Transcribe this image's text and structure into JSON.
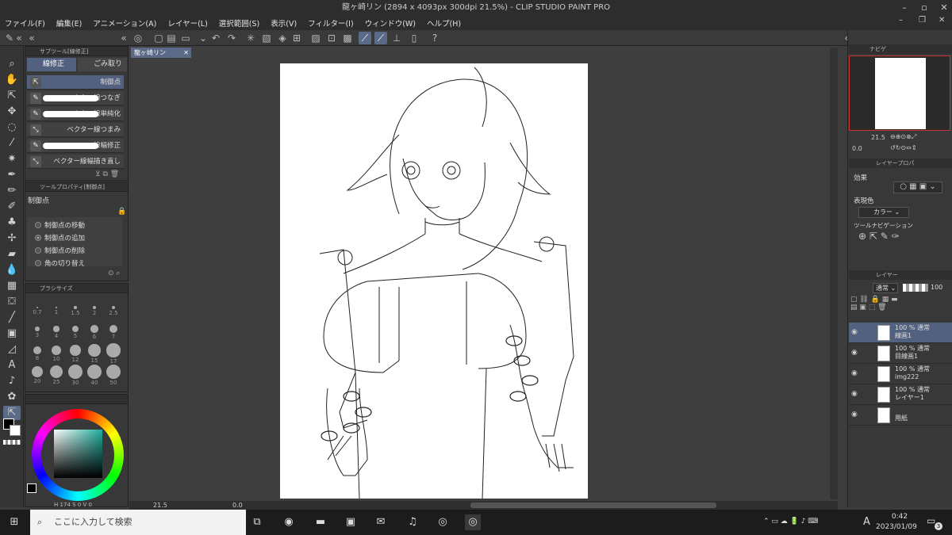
{
  "window": {
    "title": "龍ヶ崎リン (2894 x 4093px 300dpi 21.5%)  - CLIP STUDIO PAINT PRO"
  },
  "menu": [
    "ファイル(F)",
    "編集(E)",
    "アニメーション(A)",
    "レイヤー(L)",
    "選択範囲(S)",
    "表示(V)",
    "フィルター(I)",
    "ウィンドウ(W)",
    "ヘルプ(H)"
  ],
  "subtool": {
    "header": "サブツール[線修正]",
    "tabs": [
      "線修正",
      "ごみ取り"
    ],
    "items": [
      "制御点",
      "ベクター線つなぎ",
      "ベクター線単純化",
      "ベクター線つまみ",
      "線幅修正",
      "ベクター線幅描き直し"
    ]
  },
  "toolprop": {
    "header": "ツールプロパティ[制御点]",
    "name": "制御点",
    "options": [
      "制御点の移動",
      "制御点の追加",
      "制御点の削除",
      "角の切り替え"
    ],
    "selected_index": 1
  },
  "brushsize": {
    "header": "ブラシサイズ",
    "values": [
      "0.7",
      "1",
      "1.5",
      "2",
      "2.5",
      "3",
      "4",
      "5",
      "6",
      "7",
      "8",
      "10",
      "12",
      "15",
      "17",
      "20",
      "25",
      "30",
      "40",
      "50"
    ]
  },
  "color": {
    "values": [
      "174",
      "0",
      "0"
    ],
    "labels": [
      "H",
      "S",
      "V"
    ]
  },
  "canvas": {
    "tab": "龍ヶ崎リン"
  },
  "statusbar": {
    "zoom": "21.5",
    "angle": "0.0"
  },
  "navigator": {
    "tabs": [
      "ナビゲ"
    ],
    "zoom": "21.5",
    "angle": "0.0"
  },
  "layerprop": {
    "header": "レイヤープロパ",
    "effect_label": "効果",
    "color_label": "表現色",
    "color_value": "カラー",
    "toolnav_label": "ツールナビゲーション"
  },
  "layers": {
    "header": "レイヤー",
    "blend": "通常",
    "opacity": "100",
    "items": [
      {
        "pct": "100 % 通常",
        "name": "線画1"
      },
      {
        "pct": "100 % 通常",
        "name": "目線画1"
      },
      {
        "pct": "100 % 通常",
        "name": "img222"
      },
      {
        "pct": "100 % 通常",
        "name": "レイヤー1"
      },
      {
        "pct": "",
        "name": "用紙"
      }
    ]
  },
  "taskbar": {
    "search_placeholder": "ここに入力して検索",
    "time": "0:42",
    "date": "2023/01/09",
    "ime": "A",
    "notif": "3"
  }
}
